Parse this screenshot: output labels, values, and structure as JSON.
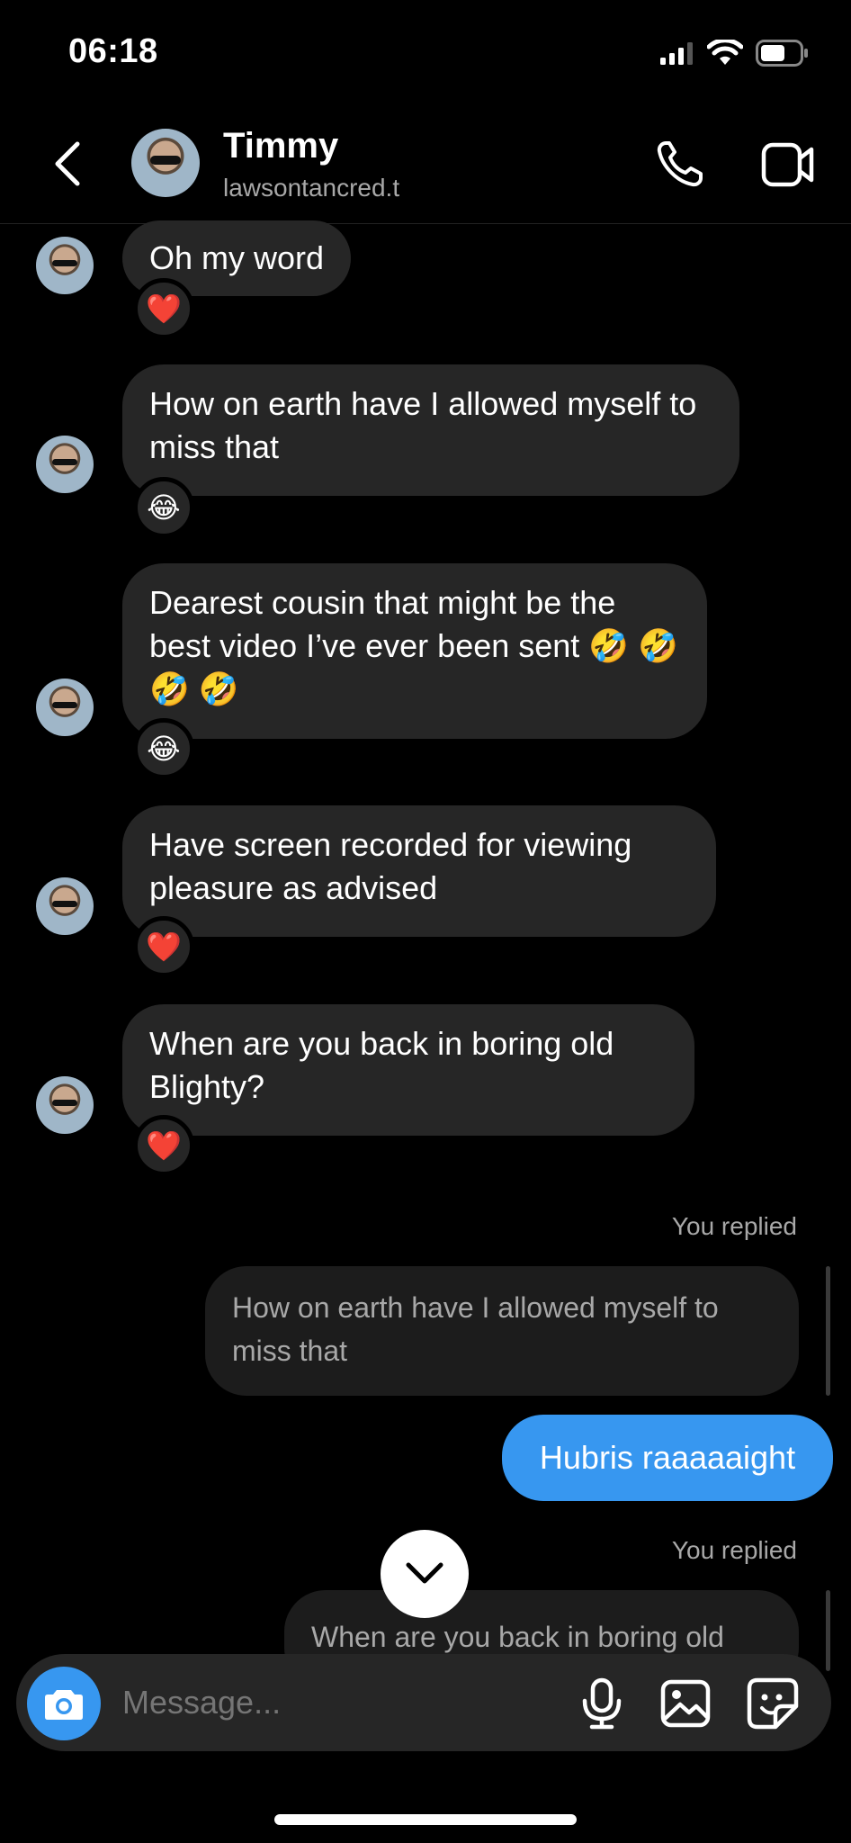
{
  "status_bar": {
    "time": "06:18",
    "icons": [
      "signal-icon",
      "wifi-icon",
      "battery-icon"
    ]
  },
  "header": {
    "name": "Timmy",
    "handle": "lawsontancred.t",
    "icons": [
      "back-icon",
      "phone-icon",
      "video-icon"
    ]
  },
  "messages": [
    {
      "text": "Oh my word",
      "reaction": "❤️"
    },
    {
      "text": "How on earth have I allowed myself to miss that",
      "reaction": "😂"
    },
    {
      "text": "Dearest cousin that might be the best video I’ve ever been sent 🤣 🤣 🤣 🤣",
      "reaction": "😂"
    },
    {
      "text": "Have screen recorded for viewing pleasure as advised",
      "reaction": "❤️"
    },
    {
      "text": "When are you back in boring old Blighty?",
      "reaction": "❤️"
    }
  ],
  "replies": [
    {
      "label": "You replied",
      "quote": "How on earth have I allowed myself to miss that",
      "message": "Hubris raaaaaight"
    },
    {
      "label": "You replied",
      "quote": "When are you back in boring old"
    }
  ],
  "composer": {
    "placeholder": "Message...",
    "icons": [
      "camera-icon",
      "microphone-icon",
      "gallery-icon",
      "sticker-icon"
    ]
  },
  "colors": {
    "accent": "#3797f0",
    "bubble": "#262626",
    "background": "#000000"
  }
}
